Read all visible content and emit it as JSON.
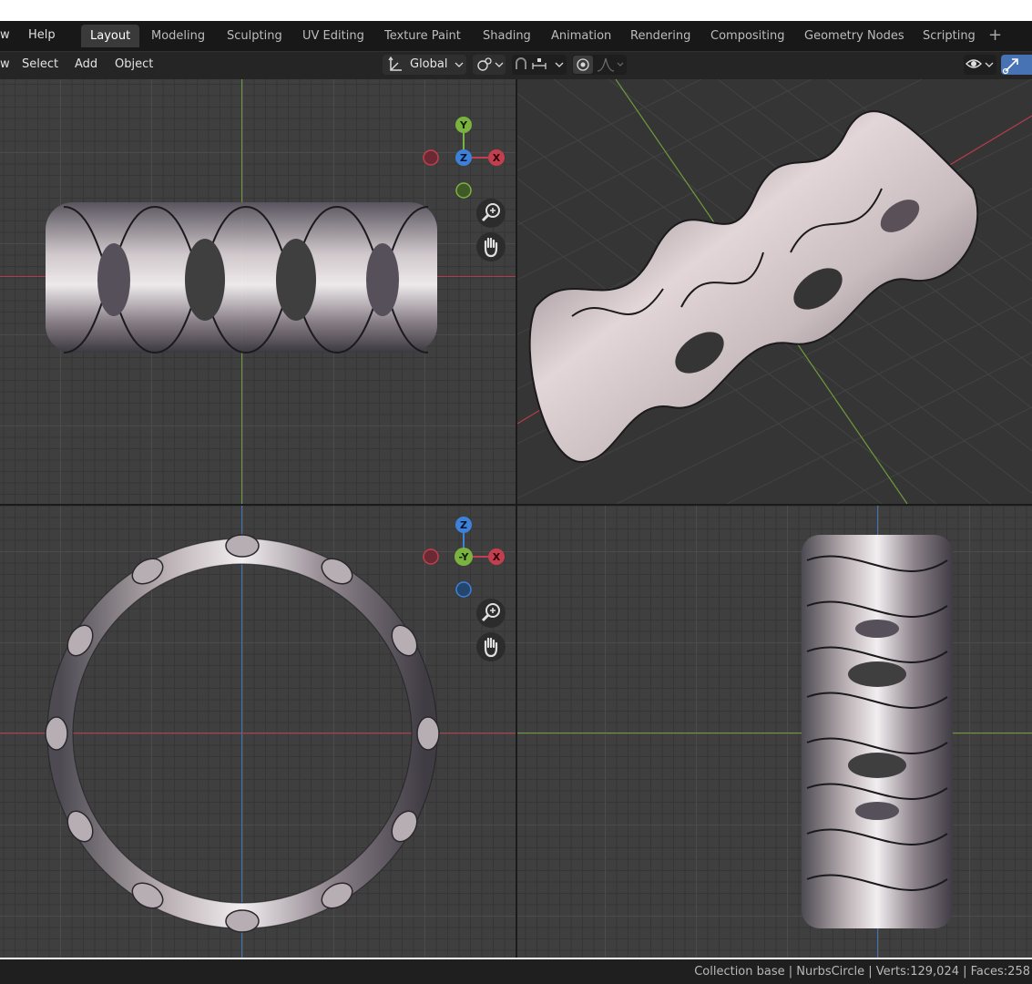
{
  "topbar": {
    "menus": [
      "w",
      "Help"
    ],
    "workspaces": [
      "Layout",
      "Modeling",
      "Sculpting",
      "UV Editing",
      "Texture Paint",
      "Shading",
      "Animation",
      "Rendering",
      "Compositing",
      "Geometry Nodes",
      "Scripting"
    ],
    "active_workspace": "Layout",
    "add_label": "+"
  },
  "header": {
    "menus": [
      "w",
      "Select",
      "Add",
      "Object"
    ],
    "orientation_label": "Global"
  },
  "viewports": {
    "top_left": {
      "gizmo_labels": [
        "Y",
        "Z",
        "X"
      ]
    },
    "bottom_left": {
      "gizmo_labels": [
        "Z",
        "-Y",
        "X"
      ]
    }
  },
  "icons": {
    "orientation": "transform-orientation-icon",
    "pivot": "pivot-point-icon",
    "snap": "snap-icon",
    "proportional": "proportional-editing-icon",
    "visibility": "eye-icon",
    "gizmo": "gizmo-toggle-icon",
    "zoom": "magnifier-zoom-icon",
    "pan": "hand-pan-icon"
  },
  "colors": {
    "x_axis": "#c23f4f",
    "y_axis": "#7bb341",
    "z_axis": "#3d82d8",
    "active_tab": "#3a3a3a",
    "accent": "#4772b3"
  },
  "status": {
    "text": "Collection base | NurbsCircle | Verts:129,024 | Faces:258"
  }
}
